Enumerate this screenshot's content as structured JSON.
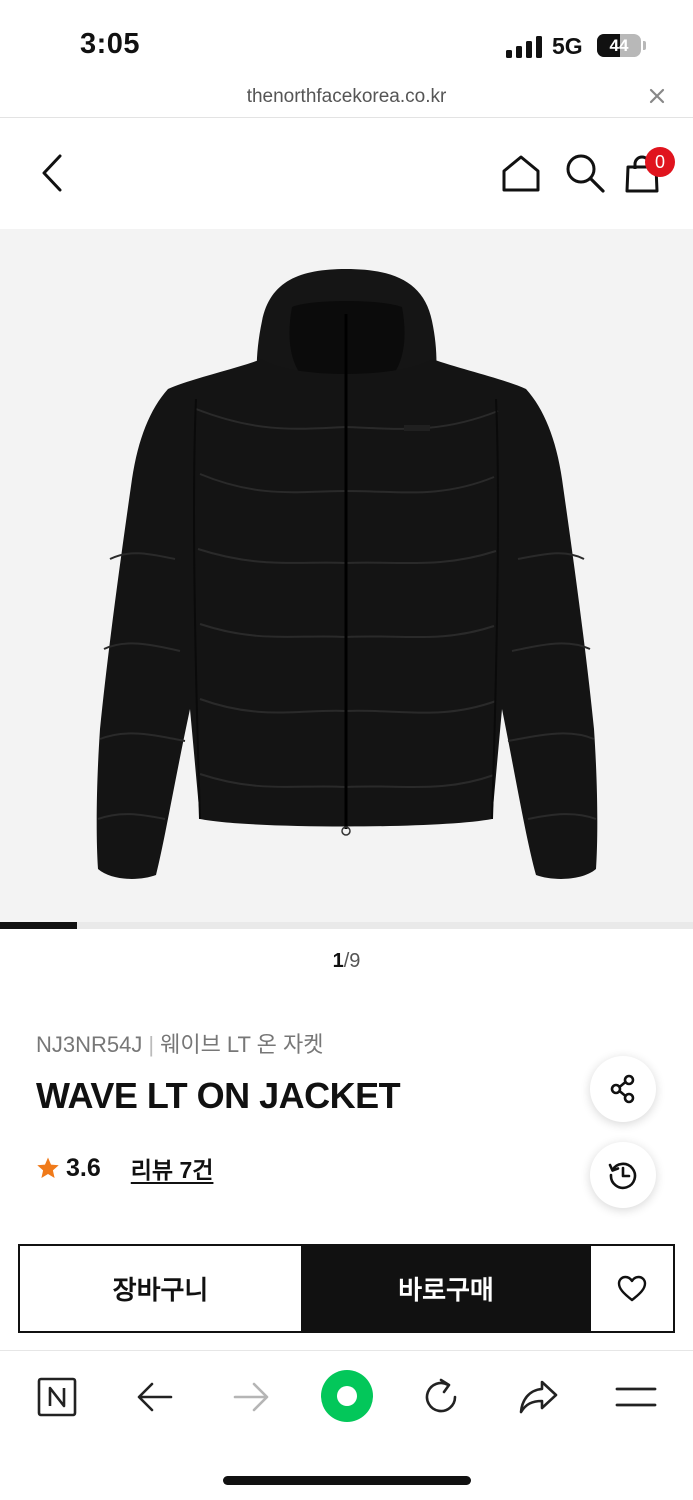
{
  "status_bar": {
    "time": "3:05",
    "network": "5G",
    "battery": "44"
  },
  "url_bar": {
    "url": "thenorthfacekorea.co.kr"
  },
  "header": {
    "cart_count": "0"
  },
  "gallery": {
    "current": "1",
    "separator": "/",
    "total": "9",
    "progress_fraction": 0.111
  },
  "product": {
    "code": "NJ3NR54J",
    "separator": "|",
    "name_ko": "웨이브 LT 온 자켓",
    "title": "WAVE LT ON JACKET",
    "rating": "3.6",
    "reviews_label": "리뷰 7건"
  },
  "actions": {
    "cart_label": "장바구니",
    "buy_label": "바로구매"
  },
  "colors": {
    "badge": "#e0141e",
    "star": "#f07a1a",
    "naver_green": "#03c75a"
  }
}
